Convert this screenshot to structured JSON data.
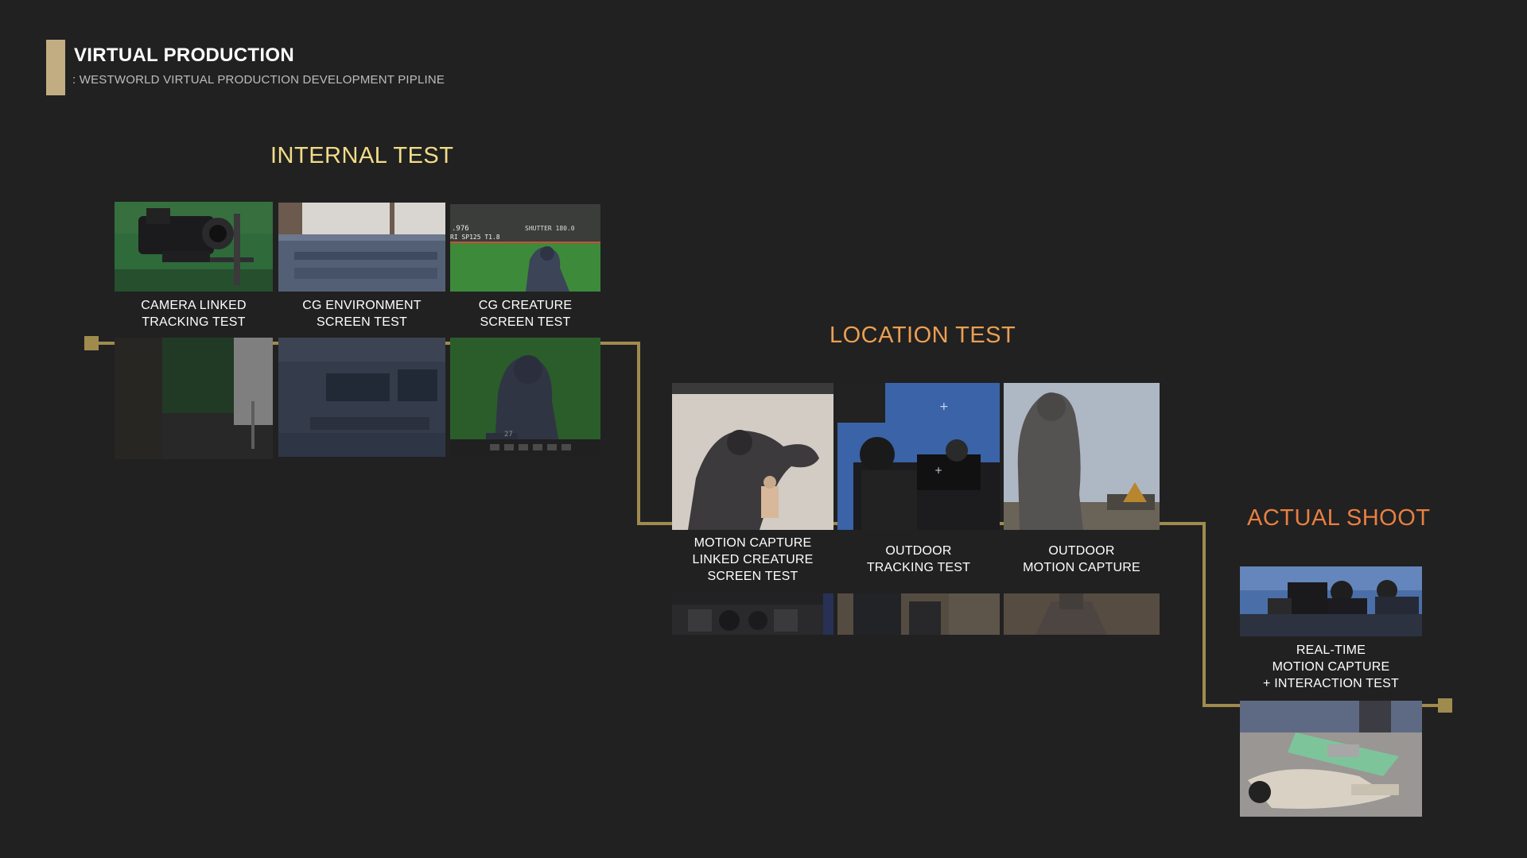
{
  "header": {
    "title": "VIRTUAL PRODUCTION",
    "subtitle": ": WESTWORLD VIRTUAL PRODUCTION DEVELOPMENT PIPLINE"
  },
  "sections": {
    "internal": {
      "title": "INTERNAL TEST",
      "items": [
        {
          "line1": "CAMERA LINKED",
          "line2": "TRACKING TEST"
        },
        {
          "line1": "CG ENVIRONMENT",
          "line2": "SCREEN TEST"
        },
        {
          "line1": "CG CREATURE",
          "line2": "SCREEN TEST"
        }
      ]
    },
    "location": {
      "title": "LOCATION TEST",
      "items": [
        {
          "line1": "MOTION CAPTURE",
          "line2": "LINKED CREATURE",
          "line3": "SCREEN TEST"
        },
        {
          "line1": "OUTDOOR",
          "line2": "TRACKING TEST"
        },
        {
          "line1": "OUTDOOR",
          "line2": "MOTION CAPTURE"
        }
      ]
    },
    "actual": {
      "title": "ACTUAL SHOOT",
      "items": [
        {
          "line1": "REAL-TIME",
          "line2": "MOTION CAPTURE",
          "line3": "+ INTERACTION TEST"
        }
      ]
    }
  },
  "photo_text": {
    "monitor_fps": ".976",
    "monitor_lens": "RI SP125 T1.8",
    "monitor_shutter": "SHUTTER 180.0",
    "monitor_num": "27"
  },
  "colors": {
    "background": "#212121",
    "accent_bar": "#c2ad83",
    "pipeline": "#a08b4e",
    "internal_title": "#f2dc87",
    "location_title": "#eb9f52",
    "actual_title": "#e97f42"
  }
}
